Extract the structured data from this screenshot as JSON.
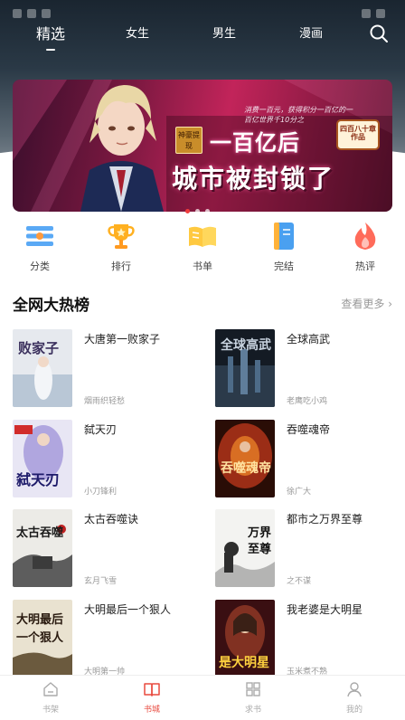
{
  "top_tabs": [
    {
      "label": "精选",
      "active": true
    },
    {
      "label": "女生",
      "active": false
    },
    {
      "label": "男生",
      "active": false
    },
    {
      "label": "漫画",
      "active": false
    }
  ],
  "banner": {
    "tag": "神豪提现",
    "promo_text": "消费一百元，获得积分一百亿的一百亿世界千10分之",
    "headline_1": "一百亿后",
    "headline_2": "城市被封锁了",
    "seal": "四百八十章",
    "seal_sub": "作品",
    "page_count": 3,
    "active_page": 1,
    "active_dot_color": "#f03c3c"
  },
  "categories": [
    {
      "label": "分类",
      "icon": "list-icon"
    },
    {
      "label": "排行",
      "icon": "trophy-icon"
    },
    {
      "label": "书单",
      "icon": "open-book-icon"
    },
    {
      "label": "完结",
      "icon": "bookmark-book-icon"
    },
    {
      "label": "热评",
      "icon": "flame-icon"
    }
  ],
  "section": {
    "title": "全网大热榜",
    "more": "查看更多 ›"
  },
  "books": [
    {
      "title": "大唐第一败家子",
      "author": "烟雨织轻愁"
    },
    {
      "title": "全球高武",
      "author": "老鹰吃小鸡"
    },
    {
      "title": "弑天刃",
      "author": "小刀锋利"
    },
    {
      "title": "吞噬魂帝",
      "author": "徐广大"
    },
    {
      "title": "太古吞噬诀",
      "author": "玄月飞雪"
    },
    {
      "title": "都市之万界至尊",
      "author": "之不谋"
    },
    {
      "title": "大明最后一个狠人",
      "author": "大明第一帅"
    },
    {
      "title": "我老婆是大明星",
      "author": "玉米煮不熟"
    }
  ],
  "bottom_nav": [
    {
      "label": "书架",
      "icon": "home-icon",
      "active": false
    },
    {
      "label": "书城",
      "icon": "book-city-icon",
      "active": true
    },
    {
      "label": "求书",
      "icon": "grid-icon",
      "active": false
    },
    {
      "label": "我的",
      "icon": "user-icon",
      "active": false
    }
  ],
  "colors": {
    "accent": "#e84a3f",
    "inactive_nav": "#aaaaaa"
  }
}
